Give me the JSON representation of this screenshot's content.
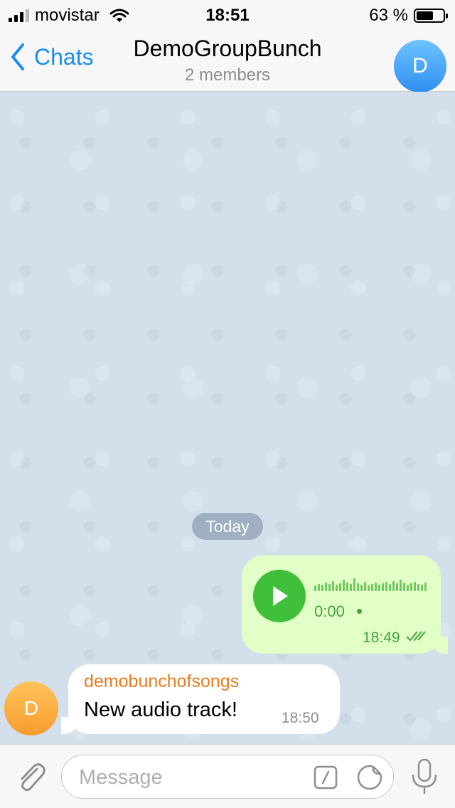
{
  "status_bar": {
    "carrier": "movistar",
    "time": "18:51",
    "battery_text": "63 %",
    "battery_level": 0.63
  },
  "header": {
    "back_label": "Chats",
    "title": "DemoGroupBunch",
    "subtitle": "2 members",
    "avatar_letter": "D"
  },
  "chat": {
    "date_separator": "Today",
    "messages": [
      {
        "type": "voice",
        "direction": "outgoing",
        "duration": "0:00",
        "time": "18:49",
        "status_icon": "double-check-icon"
      },
      {
        "type": "text",
        "direction": "incoming",
        "sender": "demobunchofsongs",
        "avatar_letter": "D",
        "text": "New audio track!",
        "time": "18:50"
      }
    ]
  },
  "input_bar": {
    "placeholder": "Message",
    "attach_icon": "paperclip-icon",
    "command_icon": "slash-command-icon",
    "sticker_icon": "sticker-icon",
    "mic_icon": "microphone-icon"
  },
  "colors": {
    "accent": "#1a8cf0",
    "outgoing_bubble": "#e1ffc7",
    "outgoing_text": "#46a33e",
    "play_button": "#3fbf3a",
    "sender_name": "#ea7b1f",
    "chat_background": "#d3dfea"
  }
}
